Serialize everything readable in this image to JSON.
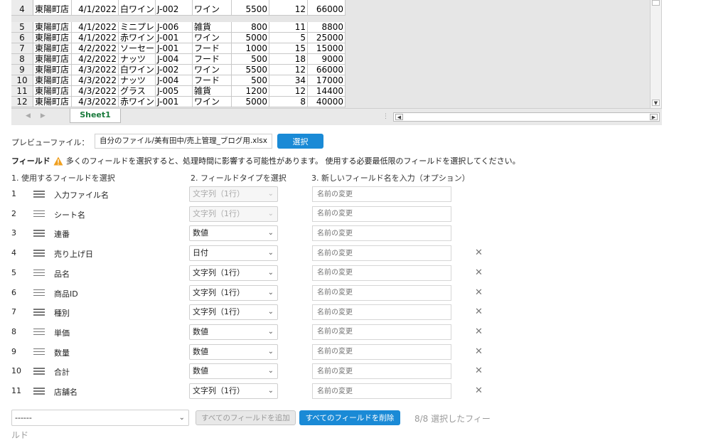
{
  "sheet": {
    "rows": [
      {
        "rn": "4",
        "store": "東陽町店",
        "date": "4/1/2022",
        "item": "白ワイン",
        "id": "J-002",
        "kind": "ワイン",
        "price": "5500",
        "qty": "12",
        "total": "66000"
      },
      {
        "rn": "5",
        "store": "東陽町店",
        "date": "4/1/2022",
        "item": "ミニプレ",
        "id": "J-006",
        "kind": "雑貨",
        "price": "800",
        "qty": "11",
        "total": "8800"
      },
      {
        "rn": "6",
        "store": "東陽町店",
        "date": "4/1/2022",
        "item": "赤ワイン",
        "id": "J-001",
        "kind": "ワイン",
        "price": "5000",
        "qty": "5",
        "total": "25000"
      },
      {
        "rn": "7",
        "store": "東陽町店",
        "date": "4/2/2022",
        "item": "ソーセー",
        "id": "J-001",
        "kind": "フード",
        "price": "1000",
        "qty": "15",
        "total": "15000"
      },
      {
        "rn": "8",
        "store": "東陽町店",
        "date": "4/2/2022",
        "item": "ナッツ",
        "id": "J-004",
        "kind": "フード",
        "price": "500",
        "qty": "18",
        "total": "9000"
      },
      {
        "rn": "9",
        "store": "東陽町店",
        "date": "4/3/2022",
        "item": "白ワイン",
        "id": "J-002",
        "kind": "ワイン",
        "price": "5500",
        "qty": "12",
        "total": "66000"
      },
      {
        "rn": "10",
        "store": "東陽町店",
        "date": "4/3/2022",
        "item": "ナッツ",
        "id": "J-004",
        "kind": "フード",
        "price": "500",
        "qty": "34",
        "total": "17000"
      },
      {
        "rn": "11",
        "store": "東陽町店",
        "date": "4/3/2022",
        "item": "グラス",
        "id": "J-005",
        "kind": "雑貨",
        "price": "1200",
        "qty": "12",
        "total": "14400"
      },
      {
        "rn": "12",
        "store": "東陽町店",
        "date": "4/3/2022",
        "item": "赤ワイン",
        "id": "J-001",
        "kind": "ワイン",
        "price": "5000",
        "qty": "8",
        "total": "40000"
      }
    ],
    "tab": "Sheet1"
  },
  "preview": {
    "label": "プレビューファイル：",
    "path": "自分のファイル/美有田中/売上管理_ブログ用.xlsx",
    "select_label": "選択"
  },
  "fields_heading": {
    "title": "フィールド",
    "warning": "多くのフィールドを選択すると、処理時間に影響する可能性があります。 使用する必要最低限のフィールドを選択してください。"
  },
  "columns": {
    "c1": "1. 使用するフィールドを選択",
    "c2": "2. フィールドタイプを選択",
    "c3": "3. 新しいフィールド名を入力（オプション）"
  },
  "rename_placeholder": "名前の変更",
  "fields": [
    {
      "num": "1",
      "name": "入力ファイル名",
      "type": "文字列（1行）",
      "disabled": true,
      "removable": false
    },
    {
      "num": "2",
      "name": "シート名",
      "type": "文字列（1行）",
      "disabled": true,
      "removable": false
    },
    {
      "num": "3",
      "name": "連番",
      "type": "数値",
      "disabled": false,
      "removable": false
    },
    {
      "num": "4",
      "name": "売り上げ日",
      "type": "日付",
      "disabled": false,
      "removable": true
    },
    {
      "num": "5",
      "name": "品名",
      "type": "文字列（1行）",
      "disabled": false,
      "removable": true
    },
    {
      "num": "6",
      "name": "商品ID",
      "type": "文字列（1行）",
      "disabled": false,
      "removable": true
    },
    {
      "num": "7",
      "name": "種別",
      "type": "文字列（1行）",
      "disabled": false,
      "removable": true
    },
    {
      "num": "8",
      "name": "単価",
      "type": "数値",
      "disabled": false,
      "removable": true
    },
    {
      "num": "9",
      "name": "数量",
      "type": "数値",
      "disabled": false,
      "removable": true
    },
    {
      "num": "10",
      "name": "合計",
      "type": "数値",
      "disabled": false,
      "removable": true
    },
    {
      "num": "11",
      "name": "店舗名",
      "type": "文字列（1行）",
      "disabled": false,
      "removable": true
    }
  ],
  "footer": {
    "select_value": "------",
    "add_all": "すべてのフィールドを追加",
    "remove_all": "すべてのフィールドを削除",
    "selected_count_1": "8/8 選択したフィー",
    "selected_count_2": "ルド"
  },
  "colors": {
    "primary": "#1a8ad6",
    "sheet_tab": "#1a7a3c",
    "warning": "#f0a020"
  }
}
